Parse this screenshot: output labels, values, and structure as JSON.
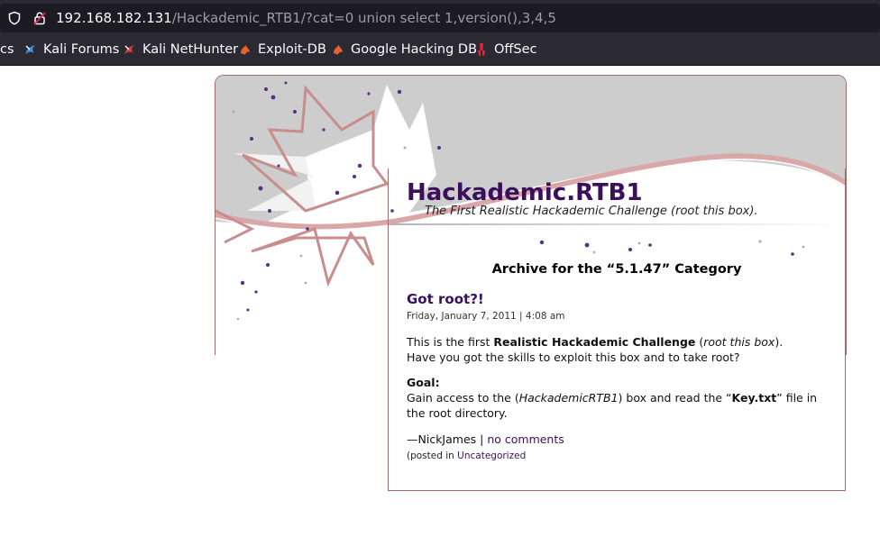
{
  "browser": {
    "url_host": "192.168.182.131",
    "url_path": "/Hackademic_RTB1/?cat=0 union select 1,version(),3,4,5",
    "bookmarks": [
      {
        "label": "cs",
        "icon": "bookmark-icon"
      },
      {
        "label": "Kali Forums",
        "icon": "kali-dragon-icon"
      },
      {
        "label": "Kali NetHunter",
        "icon": "kali-nethunter-icon"
      },
      {
        "label": "Exploit-DB",
        "icon": "exploit-db-icon"
      },
      {
        "label": "Google Hacking DB",
        "icon": "ghdb-icon"
      },
      {
        "label": "OffSec",
        "icon": "offsec-icon"
      }
    ],
    "colors": {
      "chrome": "#2b2a33",
      "urlfield": "#1c1b22"
    }
  },
  "site": {
    "title": "Hackademic.RTB1",
    "description": "The First Realistic Hackademic Challenge (root this box).",
    "colors": {
      "title": "#3b0f5c",
      "border": "#a46a6a"
    }
  },
  "archive": {
    "prefix": "Archive for the “",
    "category": "5.1.47",
    "suffix": "” Category"
  },
  "post": {
    "title": "Got root?!",
    "date": "Friday, January 7, 2011 | 4:08 am",
    "intro_a": "This is the first ",
    "intro_bold": "Realistic Hackademic Challenge",
    "intro_b": " (",
    "intro_italic": "root this box",
    "intro_c": ").",
    "intro_line2": "Have you got the skills to exploit this box and to take root?",
    "goal_label": "Goal:",
    "goal_a": "Gain access to the (",
    "goal_italic": "HackademicRTB1",
    "goal_b": ") box and read the “",
    "goal_bold": "Key.txt",
    "goal_c": "” file in the root directory.",
    "author": "—NickJames | ",
    "comments_link": "no comments",
    "posted_in": "(posted in ",
    "category_link": "Uncategorized"
  }
}
